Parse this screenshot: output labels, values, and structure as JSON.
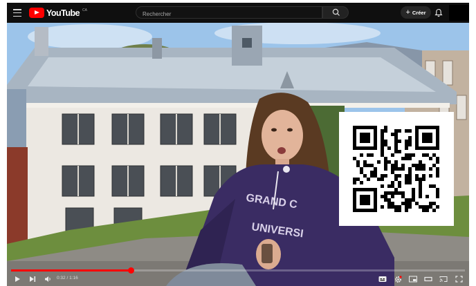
{
  "header": {
    "logo_text": "YouTube",
    "logo_country": "CA",
    "search_placeholder": "Rechercher",
    "create_label": "Créer"
  },
  "player": {
    "current_time": "0:32",
    "duration": "1:16",
    "time_display": "0:32 / 1:16",
    "progress": 0.265,
    "buttons": [
      "play",
      "next",
      "volume",
      "captions",
      "settings",
      "miniplayer",
      "theater",
      "cast",
      "fullscreen"
    ]
  },
  "colors": {
    "brand": "#ff0000",
    "background": "#0f0f0f",
    "progress": "#ff0000"
  }
}
